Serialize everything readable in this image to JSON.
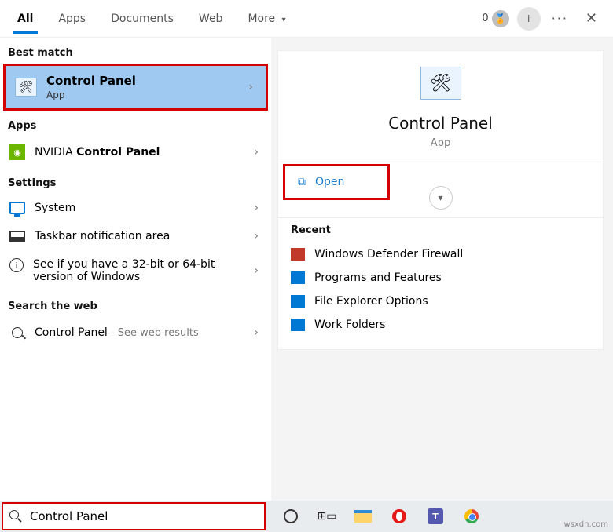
{
  "header": {
    "tabs": [
      "All",
      "Apps",
      "Documents",
      "Web",
      "More"
    ],
    "active_index": 0,
    "points": "0",
    "avatar_letter": "I"
  },
  "left": {
    "best_match_label": "Best match",
    "best_match": {
      "title": "Control Panel",
      "subtitle": "App"
    },
    "apps_label": "Apps",
    "app_result": {
      "prefix": "NVIDIA ",
      "bold": "Control Panel"
    },
    "settings_label": "Settings",
    "settings": [
      {
        "icon": "monitor",
        "text": "System"
      },
      {
        "icon": "taskbar",
        "text": "Taskbar notification area"
      },
      {
        "icon": "info",
        "text": "See if you have a 32-bit or 64-bit version of Windows"
      }
    ],
    "web_label": "Search the web",
    "web_result": {
      "text": "Control Panel",
      "suffix": " - See web results"
    }
  },
  "detail": {
    "title": "Control Panel",
    "subtitle": "App",
    "open_label": "Open",
    "recent_label": "Recent",
    "recent": [
      "Windows Defender Firewall",
      "Programs and Features",
      "File Explorer Options",
      "Work Folders"
    ]
  },
  "search": {
    "value": "Control Panel"
  },
  "watermark": "wsxdn.com"
}
